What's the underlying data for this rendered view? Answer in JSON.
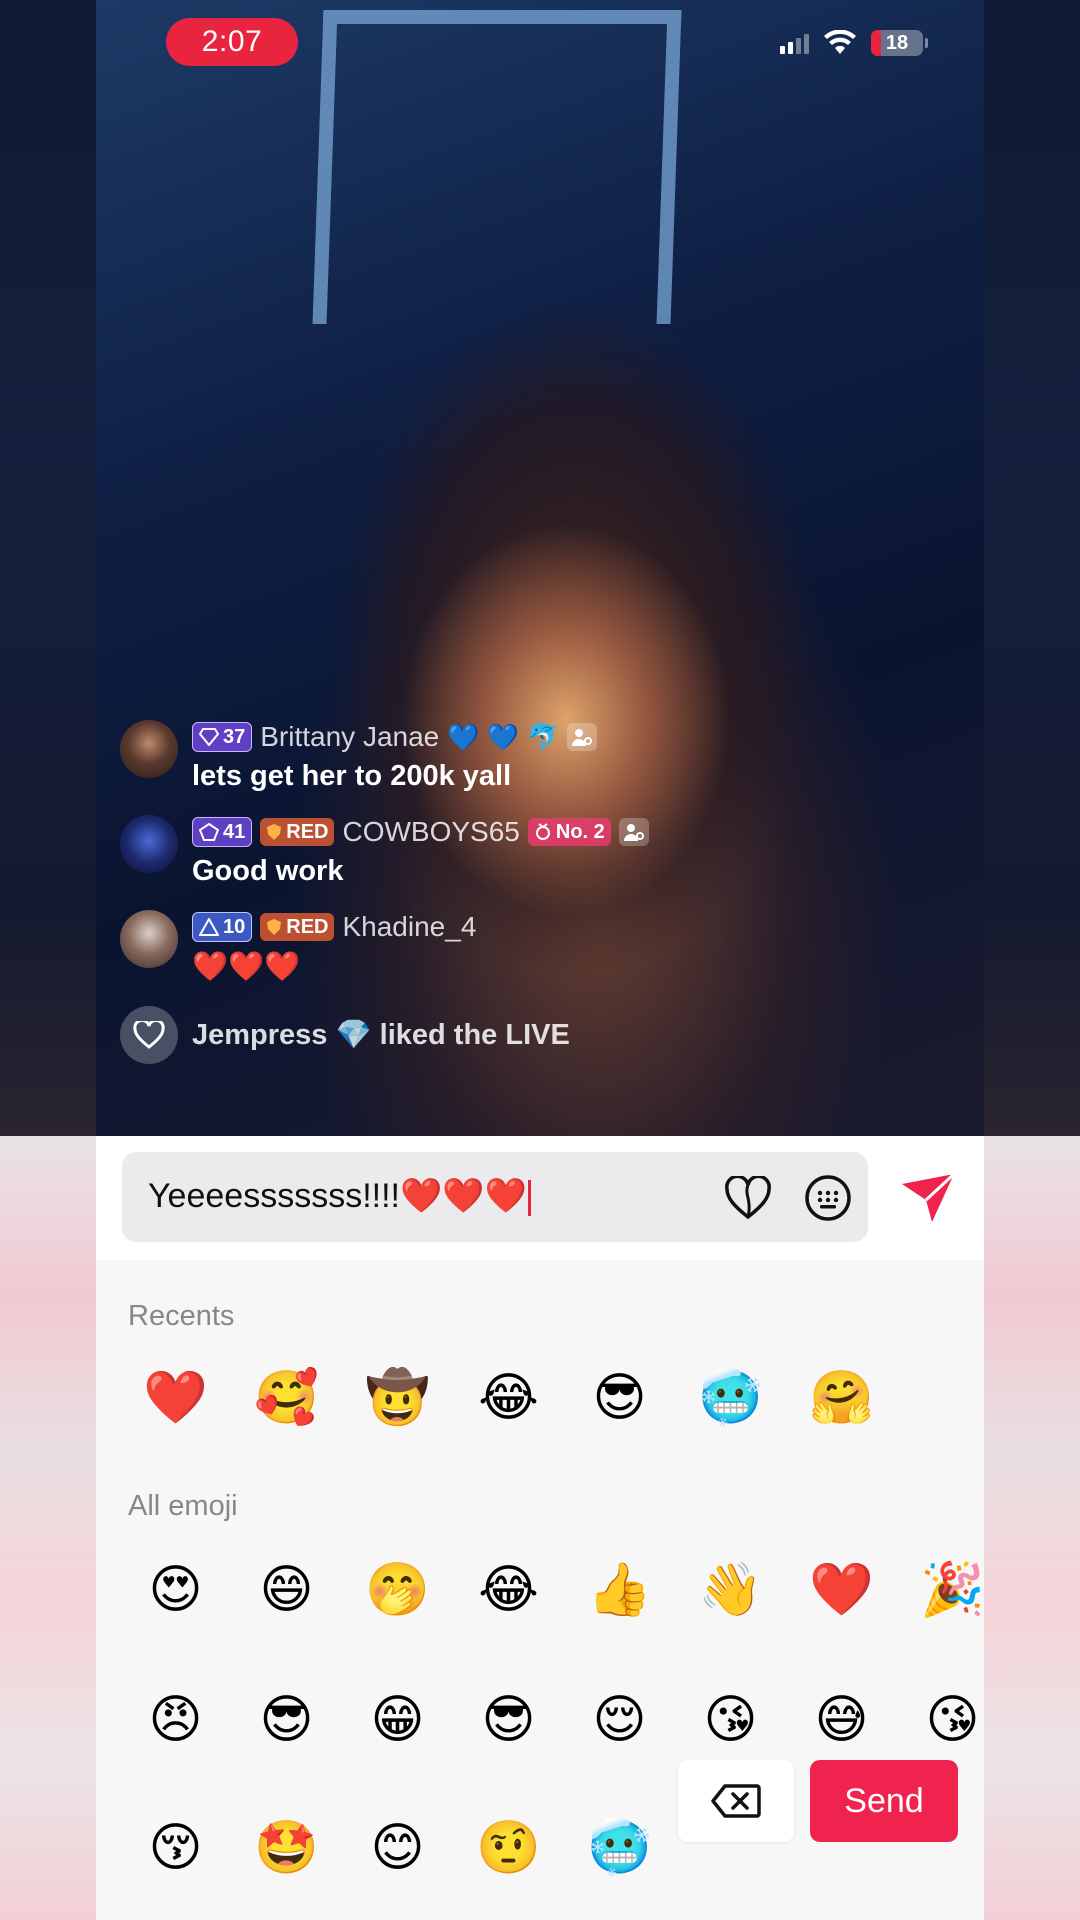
{
  "status_bar": {
    "time": "2:07",
    "battery": "18",
    "icons": [
      "signal-icon",
      "wifi-icon",
      "battery-icon"
    ]
  },
  "comments": [
    {
      "level": "37",
      "username": "Brittany Janae",
      "username_emojis": "💙 💙 🐬",
      "message": "lets get her to 200k yall"
    },
    {
      "level": "41",
      "team": "RED",
      "username": "COWBOYS65",
      "rank": "No. 2",
      "message": "Good work"
    },
    {
      "level": "10",
      "team": "RED",
      "username": "Khadine_4",
      "message": "❤️❤️❤️"
    }
  ],
  "liked_notice": {
    "text": "Jempress 💎 liked the LIVE"
  },
  "input": {
    "value": "Yeeeesssssss!!!!❤️❤️❤️"
  },
  "emoji_panel": {
    "recents_label": "Recents",
    "recents": [
      "❤️",
      "🥰",
      "🤠",
      "😂",
      "😎",
      "🥶",
      "🤗"
    ],
    "all_label": "All emoji",
    "all_rows": [
      [
        "😍",
        "😄",
        "🤭",
        "😂",
        "👍",
        "👋",
        "❤️",
        "🎉"
      ],
      [
        "😠",
        "😎",
        "😁",
        "😎",
        "😌",
        "😘",
        "😅",
        "😘"
      ],
      [
        "😚",
        "🤩",
        "😊",
        "🤨",
        "🥶",
        "",
        "",
        ""
      ]
    ]
  },
  "actions": {
    "send_label": "Send"
  },
  "colors": {
    "accent": "#f0234f",
    "time_pill": "#e8243f",
    "panel_bg": "#f7f7f8"
  }
}
